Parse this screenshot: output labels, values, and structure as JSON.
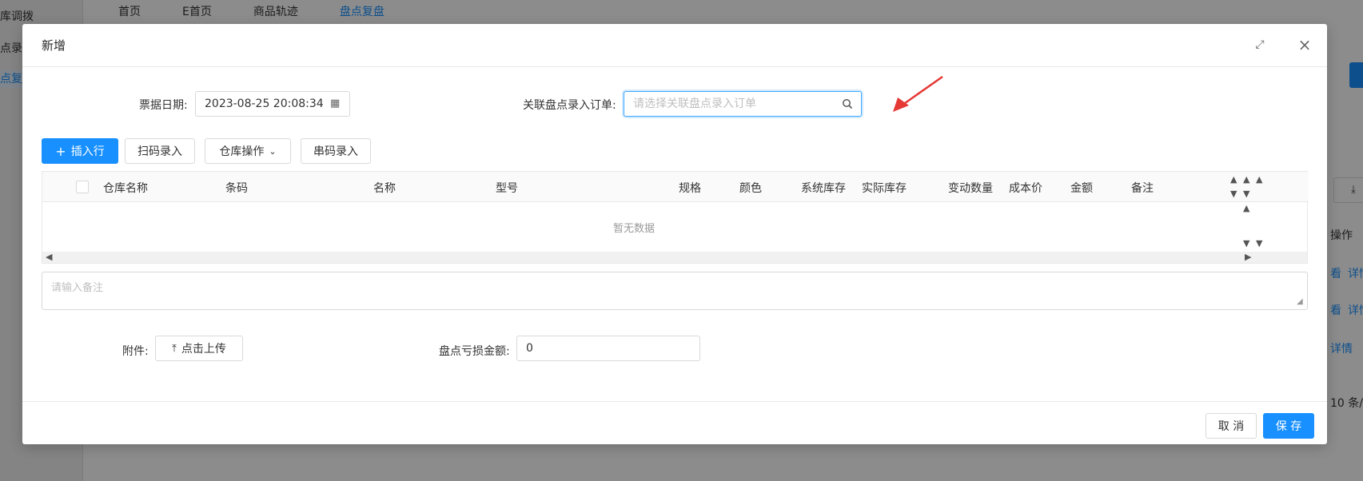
{
  "background": {
    "sidebar_items": [
      "库调拨",
      "点录入",
      "点复盘"
    ],
    "tabs": [
      "首页",
      "E首页",
      "商品轨迹",
      "盘点复盘"
    ],
    "right_texts": [
      "操作",
      "看",
      "详情",
      "看",
      "详情",
      "详情",
      "10 条/"
    ]
  },
  "modal": {
    "title": "新增",
    "date_label": "票据日期:",
    "date_value": "2023-08-25 20:08:34",
    "order_label": "关联盘点录入订单:",
    "order_placeholder": "请选择关联盘点录入订单",
    "toolbar": {
      "insert_row": "插入行",
      "scan_entry": "扫码录入",
      "warehouse_ops": "仓库操作",
      "serial_entry": "串码录入"
    },
    "table": {
      "columns": [
        "仓库名称",
        "条码",
        "名称",
        "型号",
        "规格",
        "颜色",
        "系统库存",
        "实际库存",
        "变动数量",
        "成本价",
        "金额",
        "备注"
      ],
      "empty_text": "暂无数据"
    },
    "remark_placeholder": "请输入备注",
    "attachment_label": "附件:",
    "upload_label": "点击上传",
    "loss_label": "盘点亏损金额:",
    "loss_value": "0",
    "footer": {
      "cancel": "取 消",
      "save": "保 存"
    }
  },
  "colors": {
    "primary": "#1890ff",
    "annotation_arrow": "#e53935"
  }
}
